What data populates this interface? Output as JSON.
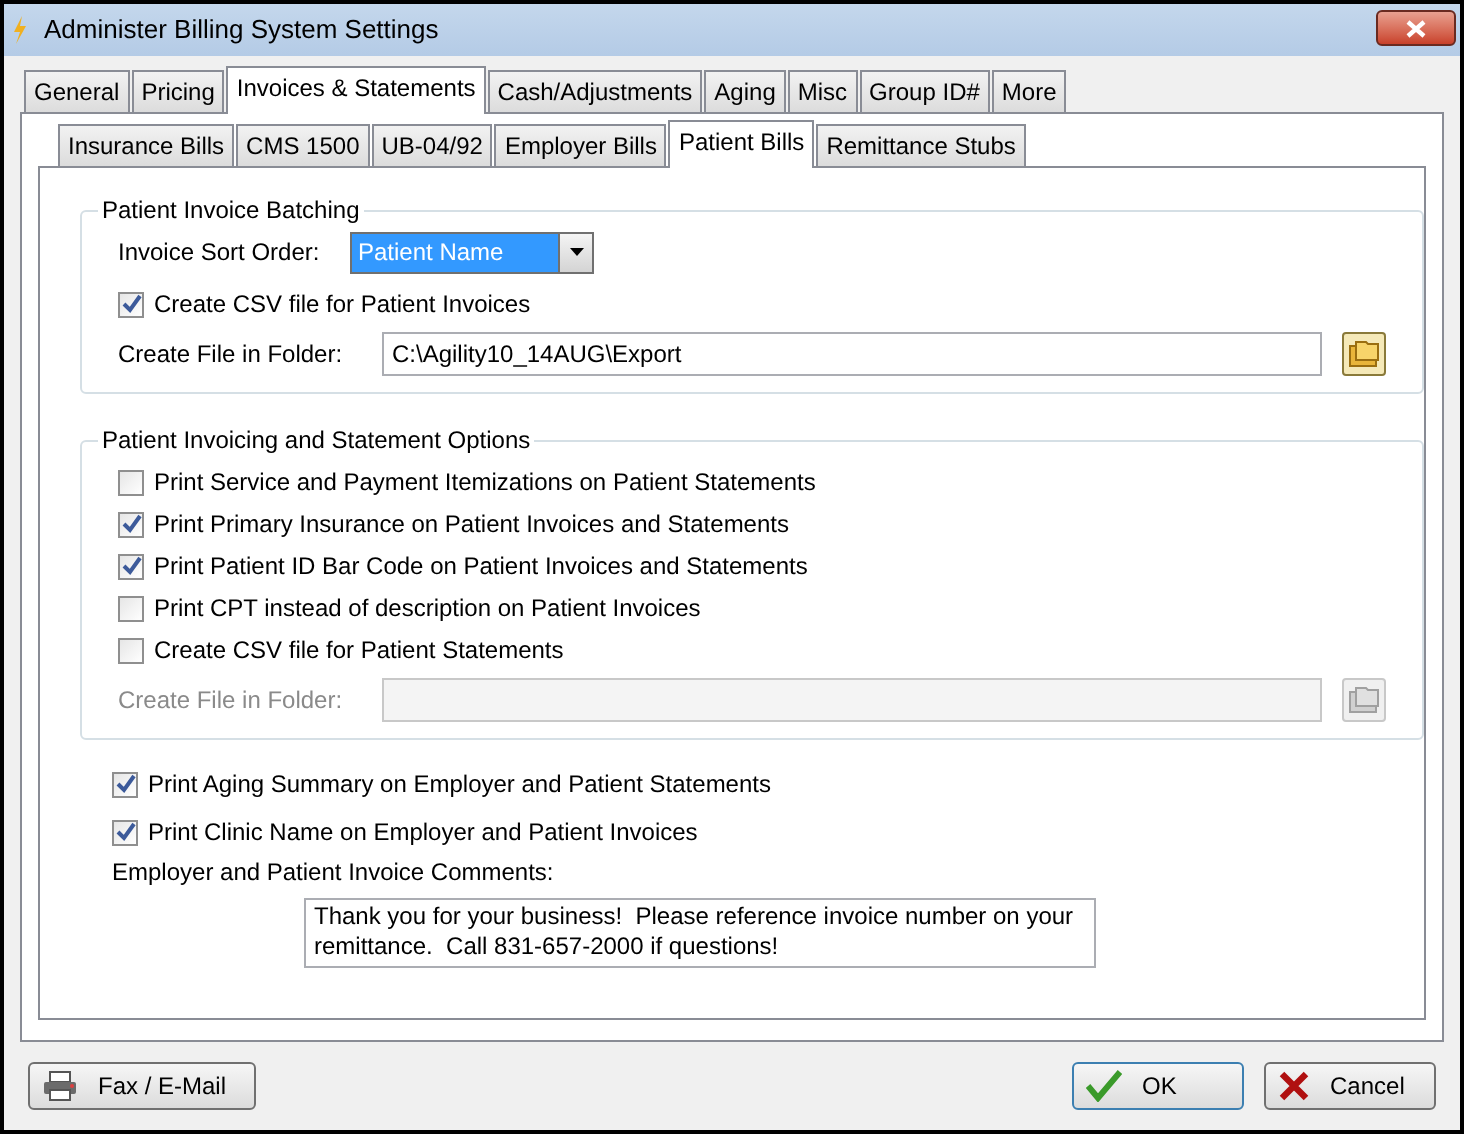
{
  "window": {
    "title": "Administer Billing System Settings"
  },
  "tabs": [
    {
      "label": "General",
      "selected": false
    },
    {
      "label": "Pricing",
      "selected": false
    },
    {
      "label": "Invoices & Statements",
      "selected": true
    },
    {
      "label": "Cash/Adjustments",
      "selected": false
    },
    {
      "label": "Aging",
      "selected": false
    },
    {
      "label": "Misc",
      "selected": false
    },
    {
      "label": "Group ID#",
      "selected": false
    },
    {
      "label": "More",
      "selected": false
    }
  ],
  "subtabs": [
    {
      "label": "Insurance Bills",
      "selected": false
    },
    {
      "label": "CMS 1500",
      "selected": false
    },
    {
      "label": "UB-04/92",
      "selected": false
    },
    {
      "label": "Employer Bills",
      "selected": false
    },
    {
      "label": "Patient Bills",
      "selected": true
    },
    {
      "label": "Remittance Stubs",
      "selected": false
    }
  ],
  "batching": {
    "title": "Patient Invoice Batching",
    "sort_label": "Invoice Sort Order:",
    "sort_value": "Patient Name",
    "csv": {
      "label": "Create CSV file for Patient Invoices",
      "checked": true
    },
    "folder_label": "Create File in Folder:",
    "folder_value": "C:\\Agility10_14AUG\\Export",
    "folder_disabled": false
  },
  "options": {
    "title": "Patient Invoicing and Statement Options",
    "checkboxes": [
      {
        "label": "Print Service and Payment Itemizations on Patient Statements",
        "checked": false
      },
      {
        "label": "Print Primary Insurance on Patient Invoices and Statements",
        "checked": true
      },
      {
        "label": "Print Patient ID Bar Code on Patient Invoices and Statements",
        "checked": true
      },
      {
        "label": "Print CPT instead of description on Patient Invoices",
        "checked": false
      },
      {
        "label": "Create CSV file for Patient Statements",
        "checked": false
      }
    ],
    "folder_label": "Create File in Folder:",
    "folder_disabled": true
  },
  "extra_checkboxes": [
    {
      "label": "Print Aging Summary on Employer and Patient Statements",
      "checked": true
    },
    {
      "label": "Print Clinic Name on Employer and Patient Invoices",
      "checked": true
    }
  ],
  "comments": {
    "label": "Employer and Patient Invoice Comments:",
    "value": "Thank you for your business!  Please reference invoice number on your remittance.  Call 831-657-2000 if questions!"
  },
  "buttons": [
    {
      "label": "Fax / E-Mail",
      "kind": "fax"
    },
    {
      "label": "OK",
      "kind": "ok"
    },
    {
      "label": "Cancel",
      "kind": "cancel"
    }
  ]
}
